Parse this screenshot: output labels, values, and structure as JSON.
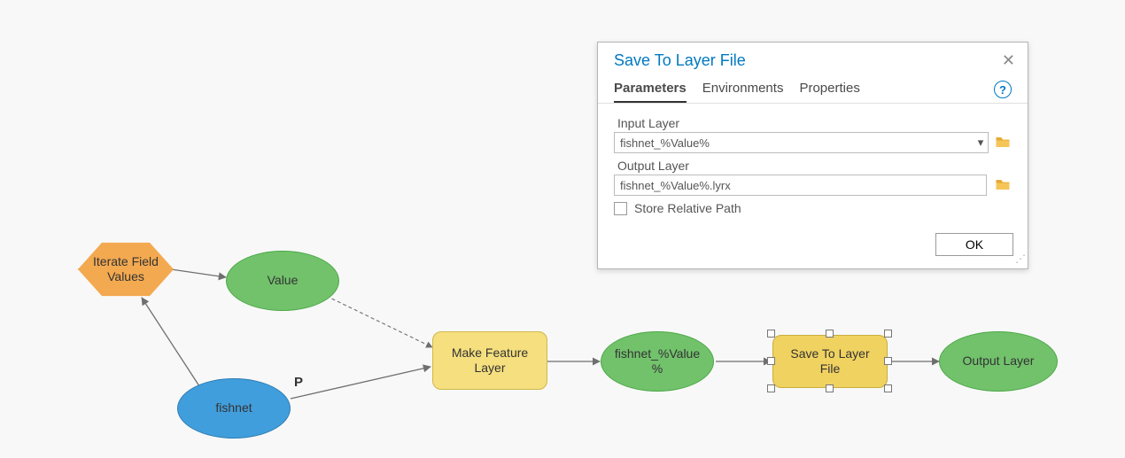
{
  "model": {
    "iterate_field_values": "Iterate Field\nValues",
    "value": "Value",
    "fishnet": "fishnet",
    "make_feature_layer": "Make Feature\nLayer",
    "fishnet_value": "fishnet_%Value\n%",
    "save_to_layer_file": "Save To Layer\nFile",
    "output_layer": "Output Layer",
    "p_label": "P"
  },
  "dialog": {
    "title": "Save To Layer File",
    "tabs": {
      "parameters": "Parameters",
      "environments": "Environments",
      "properties": "Properties"
    },
    "input_layer_label": "Input Layer",
    "input_layer_value": "fishnet_%Value%",
    "output_layer_label": "Output Layer",
    "output_layer_value": "fishnet_%Value%.lyrx",
    "store_relative_path": "Store Relative Path",
    "ok": "OK"
  },
  "colors": {
    "green": "#72c26c",
    "yellow": "#f5df7e",
    "blue": "#419edc",
    "orange": "#f3a950",
    "accent": "#0079c1"
  }
}
